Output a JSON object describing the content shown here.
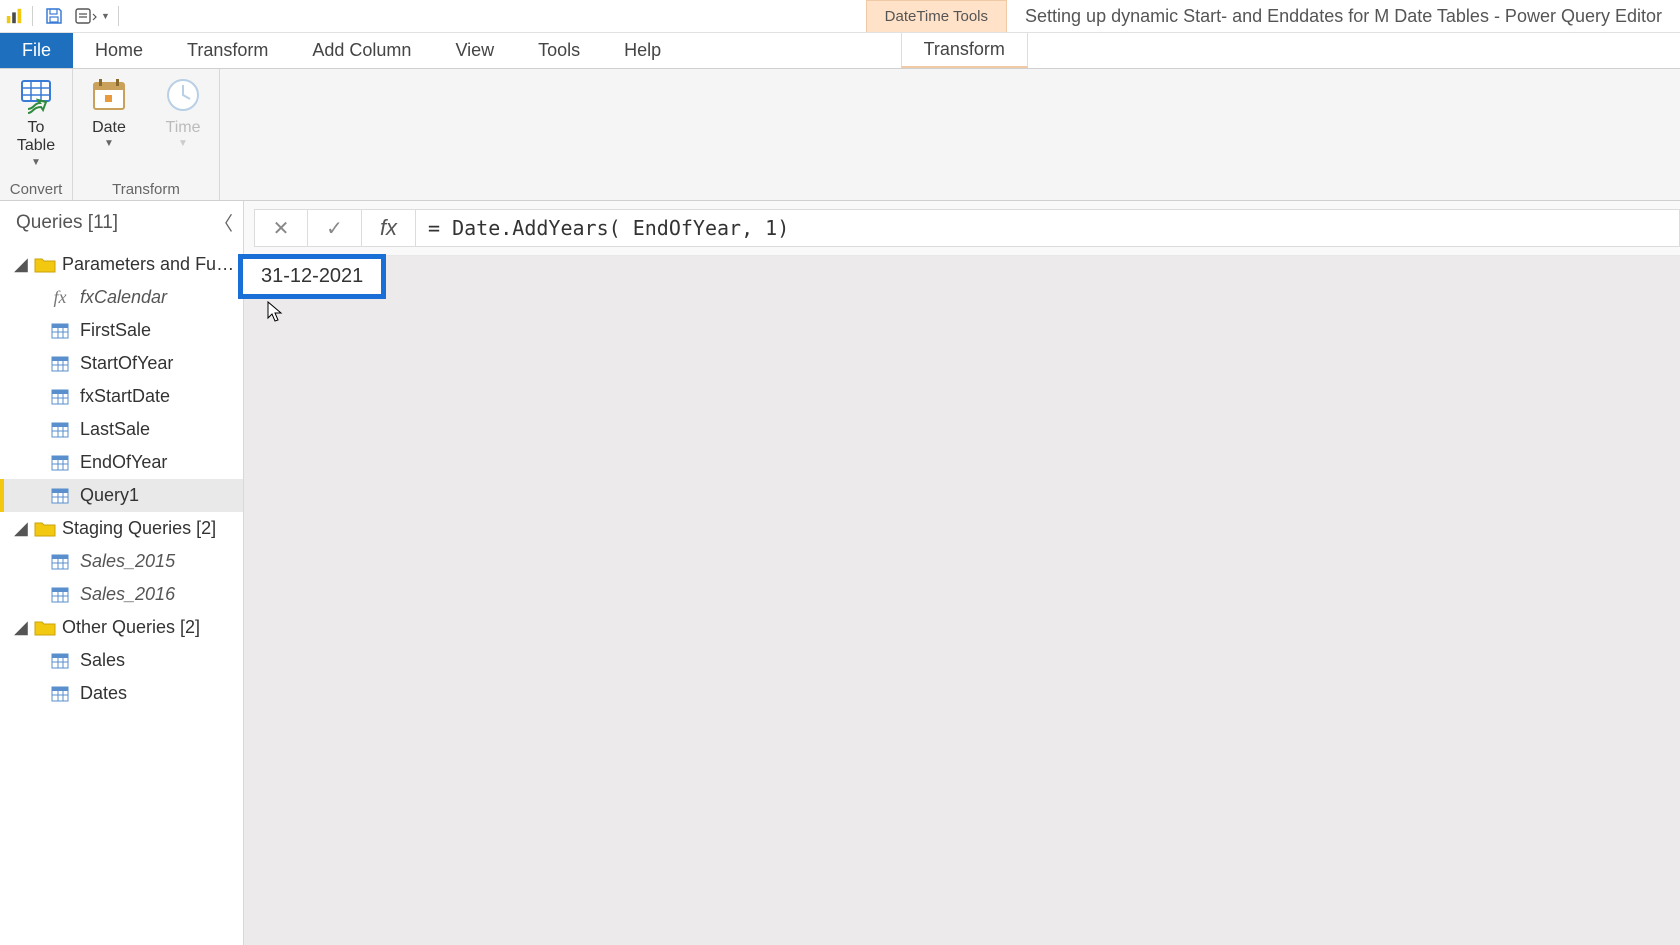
{
  "titlebar": {
    "context_tool_label": "DateTime Tools",
    "document_title": "Setting up dynamic Start- and Enddates for M Date Tables - Power Query Editor"
  },
  "ribbon_tabs": {
    "file": "File",
    "home": "Home",
    "transform": "Transform",
    "add_column": "Add Column",
    "view": "View",
    "tools": "Tools",
    "help": "Help",
    "ctx_transform": "Transform"
  },
  "ribbon": {
    "groups": {
      "convert": {
        "label": "Convert",
        "to_table": "To\nTable"
      },
      "transform": {
        "label": "Transform",
        "date": "Date",
        "time": "Time"
      }
    }
  },
  "queries_panel": {
    "title": "Queries [11]",
    "folders": {
      "params": {
        "label": "Parameters and Fu…",
        "items": [
          {
            "label": "fxCalendar",
            "type": "fx",
            "italic": true
          },
          {
            "label": "FirstSale",
            "type": "table"
          },
          {
            "label": "StartOfYear",
            "type": "table"
          },
          {
            "label": "fxStartDate",
            "type": "table"
          },
          {
            "label": "LastSale",
            "type": "table"
          },
          {
            "label": "EndOfYear",
            "type": "table"
          },
          {
            "label": "Query1",
            "type": "table",
            "selected": true
          }
        ]
      },
      "staging": {
        "label": "Staging Queries [2]",
        "items": [
          {
            "label": "Sales_2015",
            "type": "table",
            "italic": true
          },
          {
            "label": "Sales_2016",
            "type": "table",
            "italic": true
          }
        ]
      },
      "other": {
        "label": "Other Queries [2]",
        "items": [
          {
            "label": "Sales",
            "type": "table"
          },
          {
            "label": "Dates",
            "type": "table"
          }
        ]
      }
    }
  },
  "formula_bar": {
    "text": "= Date.AddYears( EndOfYear, 1)"
  },
  "preview": {
    "result": "31-12-2021"
  }
}
